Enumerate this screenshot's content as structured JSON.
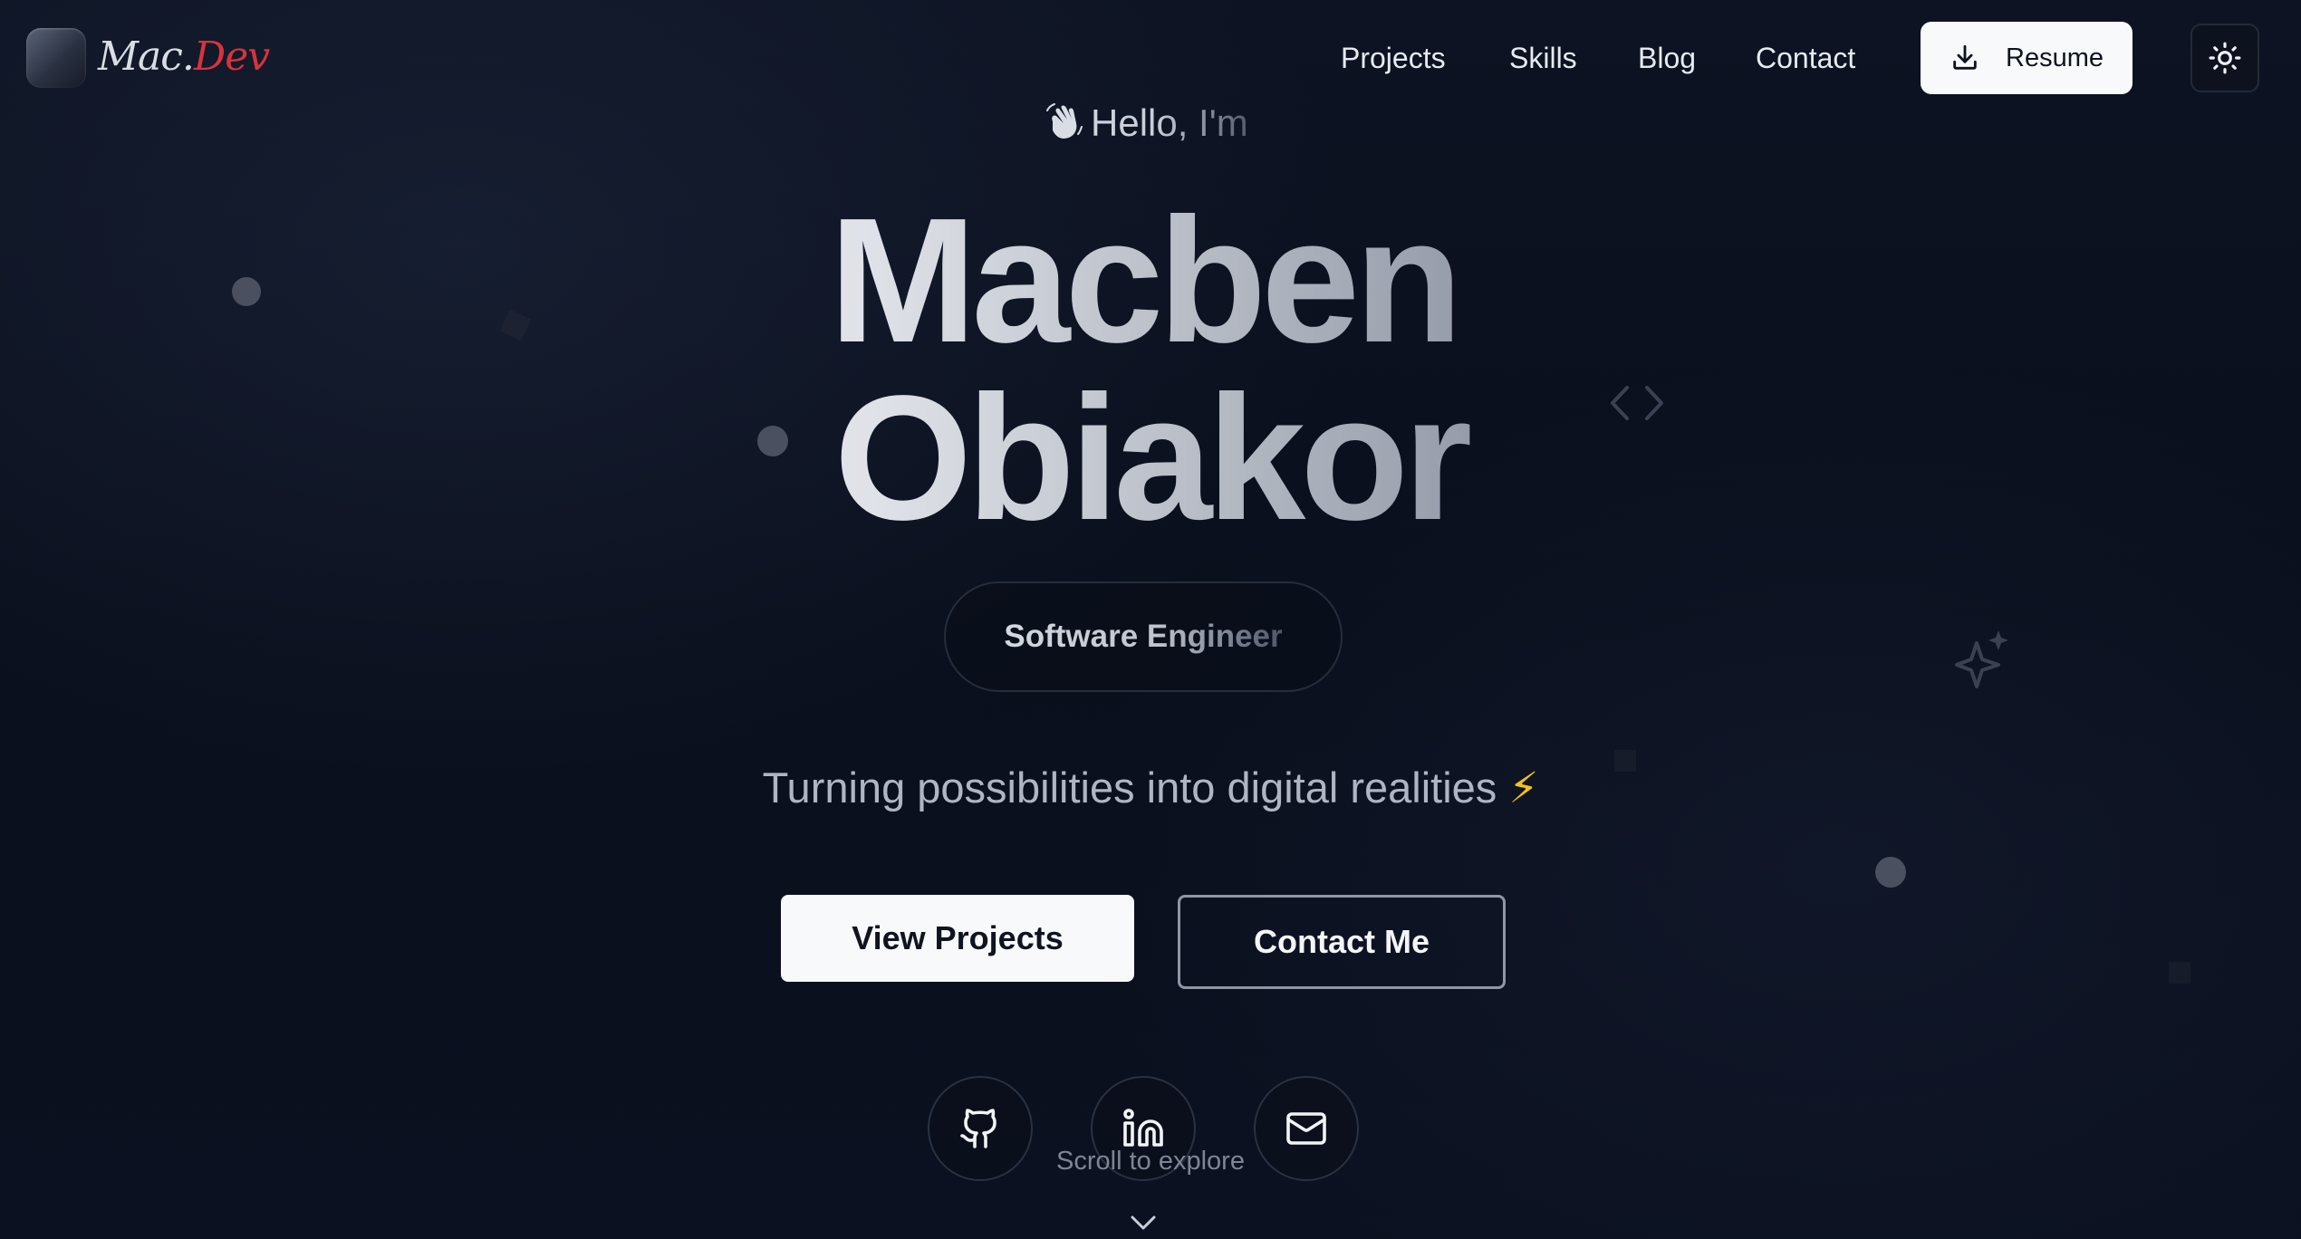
{
  "nav": {
    "logo_text_mac": "Mac.",
    "logo_text_dev": "Dev",
    "links": [
      {
        "label": "Projects"
      },
      {
        "label": "Skills"
      },
      {
        "label": "Blog"
      },
      {
        "label": "Contact"
      }
    ],
    "resume_label": "Resume",
    "resume_icon": "download-icon",
    "theme_icon": "sun-icon"
  },
  "hero": {
    "greeting": "Hello, I'm",
    "greeting_icon": "waving-hand-icon",
    "first_name": "Macben",
    "last_name": "Obiakor",
    "role": "Software Engineer",
    "tagline": "Turning possibilities into digital realities",
    "tagline_emoji": "⚡",
    "primary_cta": "View Projects",
    "secondary_cta": "Contact Me"
  },
  "social": [
    {
      "name": "github",
      "icon": "github-icon"
    },
    {
      "name": "linkedin",
      "icon": "linkedin-icon"
    },
    {
      "name": "email",
      "icon": "mail-icon"
    }
  ],
  "scroll_hint": "Scroll to explore",
  "colors": {
    "background": "#0a0f1c",
    "accent_red": "#d8333b",
    "button_light": "#f8f9fb",
    "bolt": "#f0c419"
  }
}
